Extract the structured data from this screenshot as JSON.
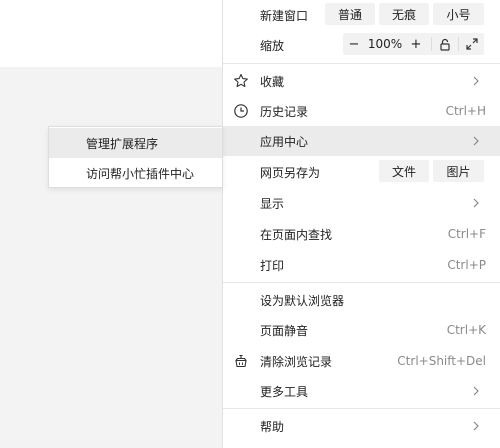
{
  "menu": {
    "new_window": {
      "label": "新建窗口",
      "buttons": [
        "普通",
        "无痕",
        "小号"
      ]
    },
    "zoom": {
      "label": "缩放",
      "minus": "−",
      "value": "100%",
      "plus": "+",
      "lock_icon": "lock-icon",
      "fullscreen_icon": "fullscreen-icon"
    },
    "favorites": {
      "label": "收藏",
      "icon": "star-icon"
    },
    "history": {
      "label": "历史记录",
      "shortcut": "Ctrl+H",
      "icon": "clock-icon"
    },
    "apps": {
      "label": "应用中心"
    },
    "save_page": {
      "label": "网页另存为",
      "buttons": [
        "文件",
        "图片"
      ]
    },
    "display": {
      "label": "显示"
    },
    "find": {
      "label": "在页面内查找",
      "shortcut": "Ctrl+F"
    },
    "print": {
      "label": "打印",
      "shortcut": "Ctrl+P"
    },
    "default_browser": {
      "label": "设为默认浏览器"
    },
    "mute": {
      "label": "页面静音",
      "shortcut": "Ctrl+K"
    },
    "clear": {
      "label": "清除浏览记录",
      "shortcut": "Ctrl+Shift+Del",
      "icon": "broom-icon"
    },
    "more_tools": {
      "label": "更多工具"
    },
    "help": {
      "label": "帮助"
    }
  },
  "submenu": {
    "items": [
      {
        "label": "管理扩展程序"
      },
      {
        "label": "访问帮小忙插件中心"
      }
    ]
  },
  "colors": {
    "menu_bg": "#ffffff",
    "highlight": "#ebebeb",
    "button_bg": "#f2f2f2",
    "shortcut": "#8a8a8a"
  }
}
